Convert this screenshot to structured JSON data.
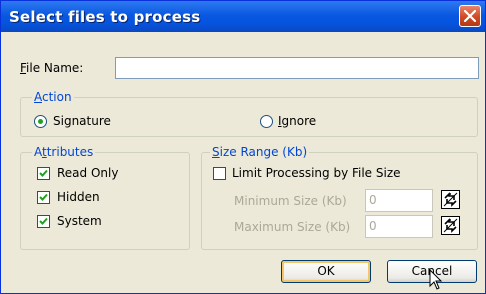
{
  "window": {
    "title": "Select files to process"
  },
  "file_name": {
    "label_first": "F",
    "label_rest": "ile Name:",
    "value": ""
  },
  "action": {
    "title_first": "A",
    "title_rest": "ction",
    "signature_label": "Signature",
    "ignore_first": "I",
    "ignore_rest": "gnore",
    "selected": "Signature"
  },
  "attributes": {
    "title_a": "A",
    "title_t": "t",
    "title_rest": "tributes",
    "read_only": "Read Only",
    "hidden": "Hidden",
    "system": "System",
    "read_only_checked": true,
    "hidden_checked": true,
    "system_checked": true
  },
  "size_range": {
    "title_first": "S",
    "title_rest": "ize Range (Kb)",
    "limit_label": "Limit Processing by File Size",
    "limit_checked": false,
    "min_label": "Minimum Size (Kb)",
    "min_value": "0",
    "max_label": "Maximum Size (Kb)",
    "max_value": "0"
  },
  "buttons": {
    "ok": "OK",
    "cancel": "Cancel"
  },
  "icons": {
    "close": "close-icon",
    "spin": "spin-arrows-icon",
    "cursor": "mouse-pointer-icon"
  }
}
